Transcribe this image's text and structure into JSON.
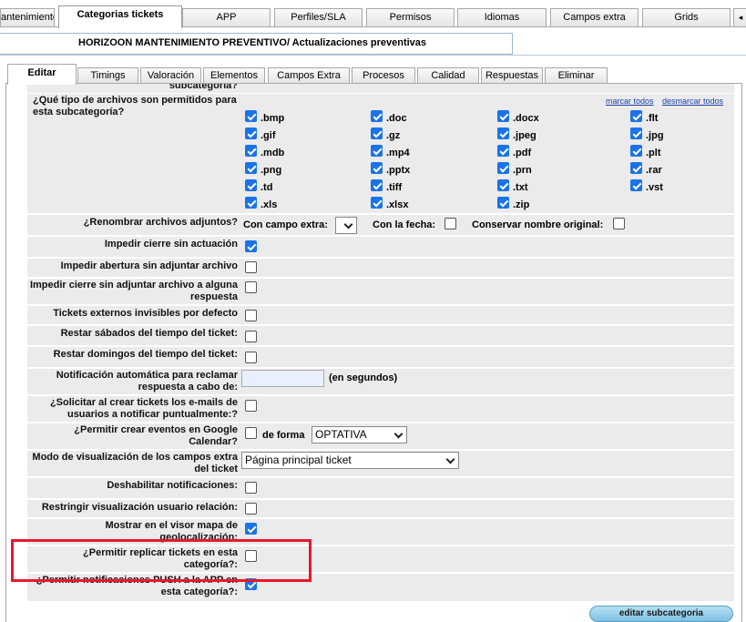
{
  "top_tabs": [
    "antenimiento",
    "Categorias tickets",
    "APP",
    "Perfiles/SLA",
    "Permisos",
    "Idiomas",
    "Campos extra",
    "Grids"
  ],
  "top_tabs_scroll": "◂",
  "subcategory_title": "HORIZOON MANTENIMIENTO PREVENTIVO/ Actualizaciones preventivas",
  "sub_tabs": [
    "Editar",
    "Timings",
    "Valoración",
    "Elementos",
    "Campos Extra",
    "Procesos",
    "Calidad",
    "Respuestas",
    "Eliminar"
  ],
  "clipped_top_text": "subcategoría?",
  "file_types": {
    "label": "¿Qué tipo de archivos son permitidos para esta subcategoría?",
    "select_all": "marcar todos",
    "deselect_all": "desmarcar todos",
    "items": [
      {
        "ext": ".bmp",
        "checked": true
      },
      {
        "ext": ".doc",
        "checked": true
      },
      {
        "ext": ".docx",
        "checked": true
      },
      {
        "ext": ".flt",
        "checked": true
      },
      {
        "ext": ".gif",
        "checked": true
      },
      {
        "ext": ".gz",
        "checked": true
      },
      {
        "ext": ".jpeg",
        "checked": true
      },
      {
        "ext": ".jpg",
        "checked": true
      },
      {
        "ext": ".mdb",
        "checked": true
      },
      {
        "ext": ".mp4",
        "checked": true
      },
      {
        "ext": ".pdf",
        "checked": true
      },
      {
        "ext": ".plt",
        "checked": true
      },
      {
        "ext": ".png",
        "checked": true
      },
      {
        "ext": ".pptx",
        "checked": true
      },
      {
        "ext": ".prn",
        "checked": true
      },
      {
        "ext": ".rar",
        "checked": true
      },
      {
        "ext": ".td",
        "checked": true
      },
      {
        "ext": ".tiff",
        "checked": true
      },
      {
        "ext": ".txt",
        "checked": true
      },
      {
        "ext": ".vst",
        "checked": true
      },
      {
        "ext": ".xls",
        "checked": true
      },
      {
        "ext": ".xlsx",
        "checked": true
      },
      {
        "ext": ".zip",
        "checked": true
      }
    ]
  },
  "rename": {
    "label": "¿Renombrar archivos adjuntos?",
    "with_extra": "Con campo extra:",
    "with_date": "Con la fecha:",
    "keep_name": "Conservar nombre original:"
  },
  "settings": [
    {
      "label": "Impedir cierre sin actuación",
      "checked": true
    },
    {
      "label": "Impedir abertura sin adjuntar archivo",
      "checked": false
    },
    {
      "label": "Impedir cierre sin adjuntar archivo a alguna respuesta",
      "checked": false
    },
    {
      "label": "Tickets externos invisibles por defecto",
      "checked": false
    },
    {
      "label": "Restar sábados del tiempo del ticket:",
      "checked": false
    },
    {
      "label": "Restar domingos del tiempo del ticket:",
      "checked": false
    }
  ],
  "auto_notify": {
    "label": "Notificación automática para reclamar respuesta a cabo de:",
    "value": "",
    "suffix": "(en segundos)"
  },
  "emails": {
    "label": "¿Solicitar al crear tickets los e-mails de usuarios a notificar puntualmente:?",
    "checked": false
  },
  "calendar": {
    "label": "¿Permitir crear eventos en Google Calendar?",
    "checked": false,
    "form_label": "de forma",
    "form_value": "OPTATIVA"
  },
  "view_mode": {
    "label": "Modo de visualización de los campos extra del ticket",
    "value": "Página principal ticket"
  },
  "settings2": [
    {
      "label": "Deshabilitar notificaciones:",
      "checked": false
    },
    {
      "label": "Restringir visualización usuario relación:",
      "checked": false
    },
    {
      "label": "Mostrar en el visor mapa de geolocalización:",
      "checked": true
    },
    {
      "label": "¿Permitir replicar tickets en esta categoría?:",
      "checked": false
    },
    {
      "label": "¿Permitir notificaciones PUSH a la APP en esta categoría?:",
      "checked": true
    }
  ],
  "edit_button": "editar subcategoria"
}
